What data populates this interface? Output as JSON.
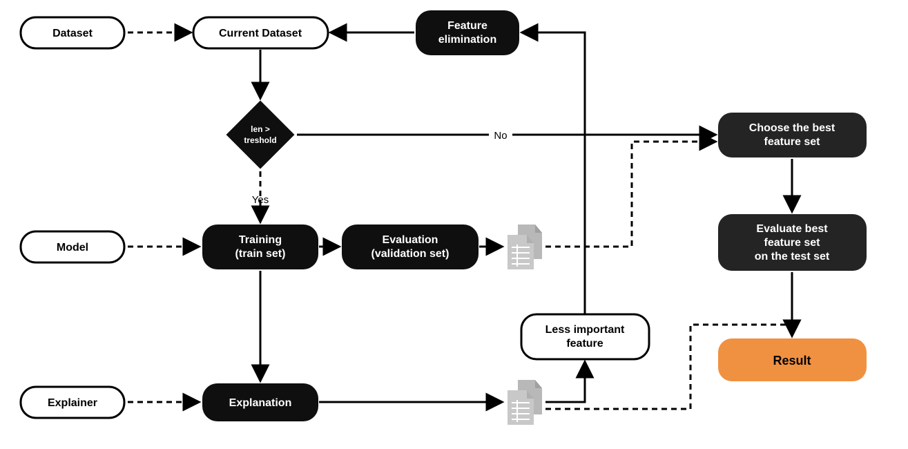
{
  "nodes": {
    "dataset": "Dataset",
    "current_dataset": "Current Dataset",
    "feature_elim_l1": "Feature",
    "feature_elim_l2": "elimination",
    "decision_l1": "len >",
    "decision_l2": "treshold",
    "model": "Model",
    "training_l1": "Training",
    "training_l2": "(train set)",
    "evaluation_l1": "Evaluation",
    "evaluation_l2": "(validation set)",
    "less_imp_l1": "Less important",
    "less_imp_l2": "feature",
    "explainer": "Explainer",
    "explanation": "Explanation",
    "choose_l1": "Choose the best",
    "choose_l2": "feature set",
    "eval_best_l1": "Evaluate best",
    "eval_best_l2": "feature set",
    "eval_best_l3": "on the test set",
    "result": "Result"
  },
  "labels": {
    "yes": "Yes",
    "no": "No"
  },
  "colors": {
    "dark": "#0f0f0f",
    "orange": "#f09142",
    "gray": "#b8b8b8"
  }
}
